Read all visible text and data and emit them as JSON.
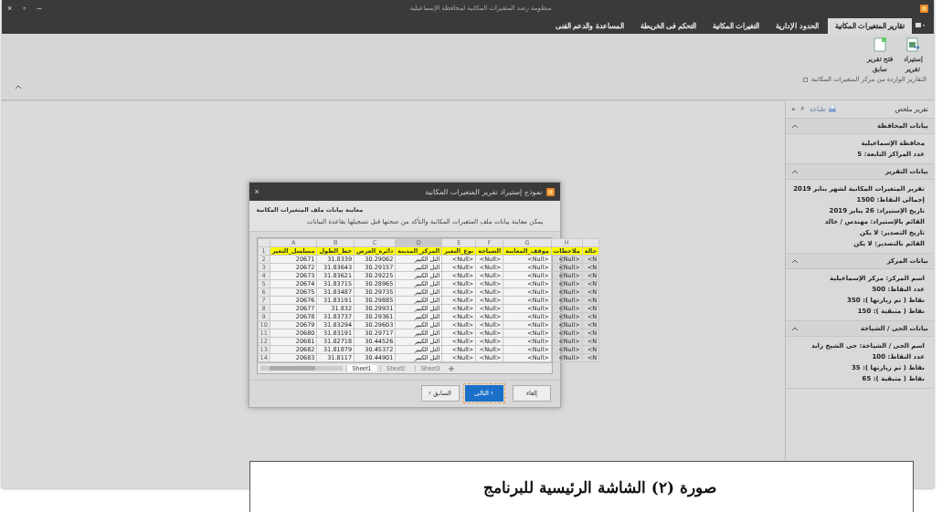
{
  "window": {
    "title": "منظومة رصد المتغيرات المكانية لمحافظة الإسماعيلية",
    "controls": [
      "–",
      "▫",
      "×"
    ]
  },
  "tabs": [
    {
      "label": "تقارير المتغيرات المكانية",
      "selected": true
    },
    {
      "label": "الحدود الإدارية",
      "selected": false
    },
    {
      "label": "التغيرات المكانية",
      "selected": false
    },
    {
      "label": "التحكم فى الخريطة",
      "selected": false
    },
    {
      "label": "المساعدة والدعم الفنى",
      "selected": false
    }
  ],
  "ribbon": {
    "buttons": [
      {
        "label": "إستيراد تقرير",
        "kind": "import"
      },
      {
        "label": "فتح تقرير سابق",
        "kind": "open"
      }
    ],
    "group_label": "التقارير الواردة من مركز المتغيرات المكانية"
  },
  "side_panel": {
    "title": "تقرير ملخص",
    "print": "طباعة",
    "pin": "ᵖ",
    "close": "×",
    "sections": [
      {
        "title": "بيانات المحافظة",
        "expanded": true,
        "lines": [
          "محافظة الإسماعيلية",
          "عدد المراكز التابعة: 5"
        ]
      },
      {
        "title": "بيانات التقرير",
        "expanded": true,
        "lines": [
          "تقرير المتغيرات المكانية لشهر يناير 2019",
          "إجمالى النقاط: 1500",
          "تاريخ الإستيراد: 26 يناير 2019",
          "القائم بالإستيراد: مهندس / خالد",
          "تاريخ التصدير: لا يكن",
          "القائم بالتصدير: لا يكن"
        ]
      },
      {
        "title": "بيانات المركز",
        "expanded": true,
        "lines": [
          "اسم المركز: مركز الإسماعيلية",
          "عدد النقاط: 500",
          "نقاط ( تم زيارتها ): 350",
          "نقاط ( متبقية ): 150"
        ]
      },
      {
        "title": "بيانات الحى / الشياخة",
        "expanded": true,
        "lines": [
          "اسم الحى / الشياخة: حى الشيخ زايد",
          "عدد النقاط: 100",
          "نقاط ( تم زيارتها ): 35",
          "نقاط ( متبقية ): 65"
        ]
      }
    ]
  },
  "dialog": {
    "title": "نموذج إستيراد تقرير المتغيرات المكانية",
    "close": "×",
    "heading": "معاينة بيانات ملف المتغيرات المكانية",
    "description": "يمكن معاينة بيانات ملف المتغيرات المكانية والتأكد من صحتها قبل تسجيلها بقاعدة البيانات",
    "sheet": {
      "columns": [
        "",
        "H",
        "G",
        "F",
        "E",
        "D",
        "C",
        "B",
        "A"
      ],
      "header_row": {
        "number": "1",
        "cells": [
          "حالة",
          "ملاحظات",
          "موقف_المعاينة",
          "الشياخة",
          "نوع_التغير",
          "المركز_المدينة",
          "دائرة_العرض",
          "خط_الطول",
          "مسلسل_التغير"
        ]
      },
      "rows": [
        {
          "number": "2",
          "cells": [
            "<N",
            "<Null>",
            "<Null>",
            "<Null>",
            "<Null>",
            "التل الكبير",
            "30.29062",
            "31.8339",
            "20671"
          ]
        },
        {
          "number": "3",
          "cells": [
            "<N",
            "<Null>",
            "<Null>",
            "<Null>",
            "<Null>",
            "التل الكبير",
            "30.29157",
            "31.83643",
            "20672"
          ]
        },
        {
          "number": "4",
          "cells": [
            "<N",
            "<Null>",
            "<Null>",
            "<Null>",
            "<Null>",
            "التل الكبير",
            "30.29225",
            "31.83621",
            "20673"
          ]
        },
        {
          "number": "5",
          "cells": [
            "<N",
            "<Null>",
            "<Null>",
            "<Null>",
            "<Null>",
            "التل الكبير",
            "30.28965",
            "31.83715",
            "20674"
          ]
        },
        {
          "number": "6",
          "cells": [
            "<N",
            "<Null>",
            "<Null>",
            "<Null>",
            "<Null>",
            "التل الكبير",
            "30.29735",
            "31.83487",
            "20675"
          ]
        },
        {
          "number": "7",
          "cells": [
            "<N",
            "<Null>",
            "<Null>",
            "<Null>",
            "<Null>",
            "التل الكبير",
            "30.29885",
            "31.83191",
            "20676"
          ]
        },
        {
          "number": "8",
          "cells": [
            "<N",
            "<Null>",
            "<Null>",
            "<Null>",
            "<Null>",
            "التل الكبير",
            "30.29931",
            "31.832",
            "20677"
          ]
        },
        {
          "number": "9",
          "cells": [
            "<N",
            "<Null>",
            "<Null>",
            "<Null>",
            "<Null>",
            "التل الكبير",
            "30.29361",
            "31.83737",
            "20678"
          ]
        },
        {
          "number": "10",
          "cells": [
            "<N",
            "<Null>",
            "<Null>",
            "<Null>",
            "<Null>",
            "التل الكبير",
            "30.29603",
            "31.83294",
            "20679"
          ]
        },
        {
          "number": "11",
          "cells": [
            "<N",
            "<Null>",
            "<Null>",
            "<Null>",
            "<Null>",
            "التل الكبير",
            "30.29717",
            "31.83191",
            "20680"
          ]
        },
        {
          "number": "12",
          "cells": [
            "<N",
            "<Null>",
            "<Null>",
            "<Null>",
            "<Null>",
            "التل الكبير",
            "30.44526",
            "31.82718",
            "20681"
          ]
        },
        {
          "number": "13",
          "cells": [
            "<N",
            "<Null>",
            "<Null>",
            "<Null>",
            "<Null>",
            "التل الكبير",
            "30.45372",
            "31.81879",
            "20682"
          ]
        },
        {
          "number": "14",
          "cells": [
            "<N",
            "<Null>",
            "<Null>",
            "<Null>",
            "<Null>",
            "التل الكبير",
            "30.44901",
            "31.8117",
            "20683"
          ]
        }
      ],
      "sheet_tabs": [
        {
          "label": "Sheet3",
          "selected": false
        },
        {
          "label": "Sheet2",
          "selected": false
        },
        {
          "label": "Sheet1",
          "selected": true
        }
      ]
    },
    "buttons": [
      {
        "label": "إلغاء",
        "kind": "cancel"
      },
      {
        "label": "التالى ›",
        "kind": "primary"
      },
      {
        "label": "‹ السابق",
        "kind": "secondary"
      }
    ]
  },
  "caption": "صورة (٢) الشاشة الرئيسية للبرنامج"
}
